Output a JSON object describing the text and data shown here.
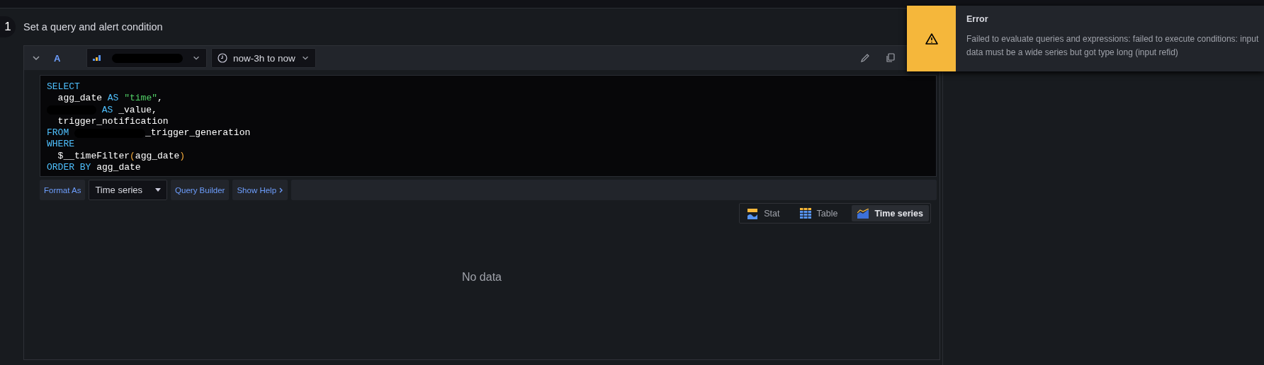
{
  "step": {
    "number": "1",
    "title": "Set a query and alert condition"
  },
  "query": {
    "ref": "A",
    "time_range": "now-3h to now",
    "code": [
      [
        {
          "kind": "keyword",
          "text": "SELECT"
        }
      ],
      [
        {
          "kind": "indent"
        },
        {
          "kind": "ident",
          "text": "agg_date "
        },
        {
          "kind": "keyword",
          "text": "AS "
        },
        {
          "kind": "string",
          "text": "\"time\""
        },
        {
          "kind": "ident",
          "text": ","
        }
      ],
      [
        {
          "kind": "redacted"
        },
        {
          "kind": "keyword",
          "text": " AS "
        },
        {
          "kind": "ident",
          "text": "_value,"
        }
      ],
      [
        {
          "kind": "indent"
        },
        {
          "kind": "ident",
          "text": "trigger_notification"
        }
      ],
      [
        {
          "kind": "keyword",
          "text": "FROM "
        },
        {
          "kind": "redacted"
        },
        {
          "kind": "ident",
          "text": "_trigger_generation"
        }
      ],
      [
        {
          "kind": "keyword",
          "text": "WHERE"
        }
      ],
      [
        {
          "kind": "indent"
        },
        {
          "kind": "ident",
          "text": "$__timeFilter"
        },
        {
          "kind": "paren",
          "text": "("
        },
        {
          "kind": "ident",
          "text": "agg_date"
        },
        {
          "kind": "paren",
          "text": ")"
        }
      ],
      [
        {
          "kind": "keyword",
          "text": "ORDER BY "
        },
        {
          "kind": "ident",
          "text": "agg_date"
        }
      ]
    ],
    "toolbar": [
      {
        "kind": "label",
        "text": "Format As"
      },
      {
        "kind": "select",
        "text": "Time series"
      },
      {
        "kind": "button",
        "text": "Query Builder"
      },
      {
        "kind": "toggle",
        "text": "Show Help"
      }
    ],
    "visualizations": [
      {
        "kind": "stat",
        "label": "Stat",
        "selected": false
      },
      {
        "kind": "table",
        "label": "Table",
        "selected": false
      },
      {
        "kind": "timeseries",
        "label": "Time series",
        "selected": true
      }
    ],
    "empty_message": "No data"
  },
  "toast": {
    "title": "Error",
    "message": "Failed to evaluate queries and expressions: failed to execute conditions: input data must be a wide series but got type long (input refid)"
  }
}
